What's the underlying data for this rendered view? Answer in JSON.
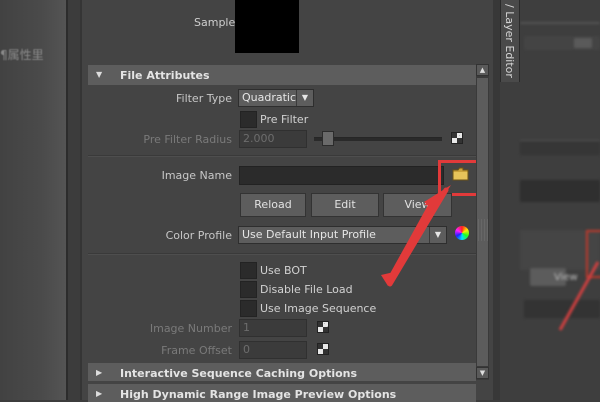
{
  "background": {
    "left_text": "¶属性里",
    "right_tab": "/ Layer Editor",
    "right_button": "View"
  },
  "sample": {
    "label": "Sample",
    "color": "#000000"
  },
  "file_attributes": {
    "header": "File Attributes",
    "filter_type_label": "Filter Type",
    "filter_type_value": "Quadratic",
    "pre_filter_label": "Pre Filter",
    "pre_filter_radius_label": "Pre Filter Radius",
    "pre_filter_radius_value": "2.000",
    "image_name_label": "Image Name",
    "image_name_value": "",
    "buttons": {
      "reload": "Reload",
      "edit": "Edit",
      "view": "View"
    },
    "color_profile_label": "Color Profile",
    "color_profile_value": "Use Default Input Profile",
    "use_bot": "Use BOT",
    "disable_file_load": "Disable File Load",
    "use_image_sequence": "Use Image Sequence",
    "image_number_label": "Image Number",
    "image_number_value": "1",
    "frame_offset_label": "Frame Offset",
    "frame_offset_value": "0"
  },
  "sections": {
    "interactive_caching": "Interactive Sequence Caching Options",
    "hdr_preview": "High Dynamic Range Image Preview Options"
  },
  "colors": {
    "highlight": "#e23a3a",
    "panel": "#444444",
    "header": "#5d5d5d"
  }
}
